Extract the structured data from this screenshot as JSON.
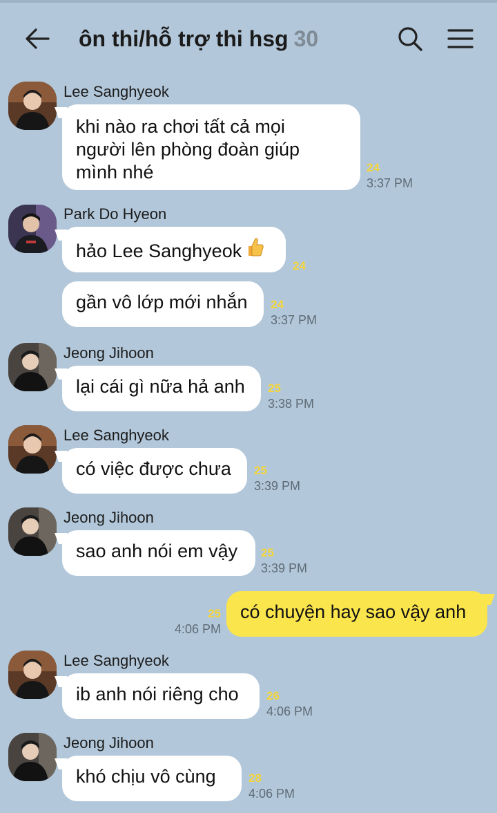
{
  "header": {
    "title": "ôn thi/hỗ trợ thi hsg",
    "member_count": "30"
  },
  "colors": {
    "background": "#b2c7d9",
    "my_bubble": "#fbe54d",
    "other_bubble": "#ffffff",
    "unread": "#f5d53a"
  },
  "messages": [
    {
      "sender": "Lee Sanghyeok",
      "lines": [
        "khi nào ra chơi tất cả mọi",
        "người lên phòng đoàn giúp",
        "mình nhé"
      ],
      "unread": "24",
      "time": "3:37 PM"
    },
    {
      "sender": "Park Do Hyeon",
      "text": "hảo Lee Sanghyeok",
      "emoji": "thumbs-up",
      "unread": "24"
    },
    {
      "text": "gần vô lớp mới nhắn",
      "unread": "24",
      "time": "3:37 PM"
    },
    {
      "sender": "Jeong Jihoon",
      "text": "lại cái gì nữa hả anh",
      "unread": "25",
      "time": "3:38 PM"
    },
    {
      "sender": "Lee Sanghyeok",
      "text": "có việc được chưa",
      "unread": "25",
      "time": "3:39 PM"
    },
    {
      "sender": "Jeong Jihoon",
      "text": "sao anh nói em vậy",
      "unread": "25",
      "time": "3:39 PM"
    },
    {
      "mine": true,
      "text": "có chuyện hay sao vậy anh",
      "unread": "25",
      "time": "4:06 PM"
    },
    {
      "sender": "Lee Sanghyeok",
      "text": "ib anh nói riêng cho",
      "unread": "26",
      "time": "4:06 PM"
    },
    {
      "sender": "Jeong Jihoon",
      "text": "khó chịu vô cùng",
      "unread": "28",
      "time": "4:06 PM"
    }
  ]
}
